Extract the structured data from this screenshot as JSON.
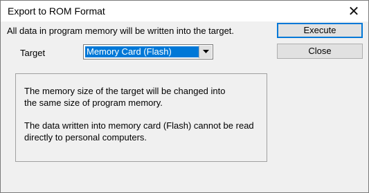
{
  "window": {
    "title": "Export to ROM Format",
    "close_glyph": "✕"
  },
  "main": {
    "message": "All data in program memory will be written into the target.",
    "target_label": "Target",
    "target_value": "Memory Card (Flash)"
  },
  "buttons": {
    "execute": "Execute",
    "close": "Close"
  },
  "info": {
    "line1": "The memory size of the target will be changed into",
    "line2": "the same size of program memory.",
    "line3": "The data written into memory card (Flash) cannot be read",
    "line4": "directly to personal computers."
  },
  "colors": {
    "selection": "#0078d7",
    "dialog_bg": "#f0f0f0",
    "button_bg": "#e1e1e1"
  }
}
